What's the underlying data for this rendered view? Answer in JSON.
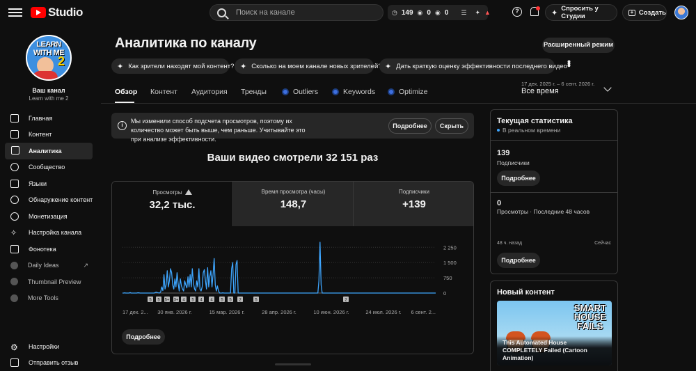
{
  "app": {
    "logo_text": "Studio"
  },
  "search": {
    "placeholder": "Поиск на канале"
  },
  "top_stats": {
    "views": "149",
    "a": "0",
    "b": "0"
  },
  "topbar": {
    "ask_label": "Спросить у Студии",
    "create_label": "Создать"
  },
  "channel": {
    "name": "Ваш канал",
    "handle": "Learn with me 2",
    "avatar_title": "LEARN WITH ME",
    "avatar_number": "2"
  },
  "sidebar": {
    "items": [
      {
        "label": "Главная",
        "icon": "dashboard-icon"
      },
      {
        "label": "Контент",
        "icon": "content-icon"
      },
      {
        "label": "Аналитика",
        "icon": "analytics-icon",
        "active": true
      },
      {
        "label": "Сообщество",
        "icon": "community-icon"
      },
      {
        "label": "Языки",
        "icon": "subtitles-icon"
      },
      {
        "label": "Обнаружение контент...",
        "icon": "copyright-icon"
      },
      {
        "label": "Монетизация",
        "icon": "monetization-icon"
      },
      {
        "label": "Настройка канала",
        "icon": "customization-icon"
      },
      {
        "label": "Фонотека",
        "icon": "audio-library-icon"
      },
      {
        "label": "Daily Ideas",
        "icon": "extension-icon"
      },
      {
        "label": "Thumbnail Preview",
        "icon": "extension-icon"
      },
      {
        "label": "More Tools",
        "icon": "extension-icon"
      }
    ],
    "bottom": [
      {
        "label": "Настройки",
        "icon": "gear-icon"
      },
      {
        "label": "Отправить отзыв",
        "icon": "feedback-icon"
      }
    ]
  },
  "page": {
    "title": "Аналитика по каналу",
    "advanced_mode": "Расширенный режим"
  },
  "chips": [
    "Как зрители находят мой контент?",
    "Сколько на моем канале новых зрителей?",
    "Дать краткую оценку эффективности последнего видео"
  ],
  "tabs": [
    "Обзор",
    "Контент",
    "Аудитория",
    "Тренды",
    "Outliers",
    "Keywords",
    "Optimize"
  ],
  "date": {
    "range": "17 дек. 2025 г. – 6 сент. 2026 г.",
    "value": "Все время"
  },
  "notice": {
    "text": "Мы изменили способ подсчета просмотров, поэтому их количество может быть выше, чем раньше. Учитывайте это при анализе эффективности.",
    "more": "Подробнее",
    "hide": "Скрыть"
  },
  "headline": "Ваши видео смотрели 32 151 раз",
  "metrics": [
    {
      "label": "Просмотры",
      "value": "32,2 тыс."
    },
    {
      "label": "Время просмотра (часы)",
      "value": "148,7"
    },
    {
      "label": "Подписчики",
      "value": "+139"
    }
  ],
  "card_more": "Подробнее",
  "chart_data": {
    "type": "line",
    "series": [
      {
        "values": [
          0,
          0,
          10,
          0,
          0,
          0,
          0,
          20,
          0,
          0,
          0,
          0,
          0,
          0,
          15,
          10,
          0,
          0,
          0,
          0,
          0,
          0,
          0,
          0,
          0,
          0,
          0,
          0,
          0,
          0,
          25,
          40,
          20,
          10,
          0,
          60,
          300,
          120,
          900,
          200,
          400,
          1100,
          300,
          600,
          1200,
          1000,
          400,
          200,
          700,
          300,
          1000,
          450,
          100,
          700,
          350,
          200,
          100,
          600,
          400,
          250,
          800,
          300,
          900,
          300,
          1200,
          500,
          200,
          100,
          600,
          300,
          1200,
          200,
          100,
          300,
          1000,
          1150,
          600,
          200,
          1250,
          300,
          800,
          1100,
          300,
          900,
          1700,
          400,
          100,
          350,
          100,
          0,
          0,
          0,
          10,
          0,
          0,
          0,
          0,
          0,
          0,
          0,
          1200,
          1500,
          0,
          0,
          1400,
          1600,
          0,
          0,
          0,
          0,
          0,
          0,
          0,
          0,
          0,
          0,
          0,
          0,
          0,
          0,
          0,
          0,
          0,
          0,
          0,
          0,
          0,
          0,
          0,
          0,
          0,
          0,
          0,
          0,
          0,
          0,
          0,
          0,
          0,
          0,
          0,
          0,
          0,
          0,
          0,
          0,
          0,
          0,
          0,
          0,
          0,
          0,
          0,
          0,
          0,
          0,
          0,
          0,
          0,
          0,
          0,
          0,
          0,
          0,
          0,
          0,
          0,
          0,
          0,
          0,
          0,
          0,
          0,
          0,
          0,
          0,
          0,
          0,
          0,
          0,
          600,
          2500,
          400,
          0,
          0,
          0,
          0,
          0,
          0,
          0,
          0,
          0,
          0,
          0,
          0,
          0,
          0,
          0,
          0,
          0,
          0,
          0,
          0,
          0,
          0,
          0,
          0,
          0,
          0,
          0,
          0,
          0,
          0,
          0,
          0,
          0,
          0,
          0,
          0,
          0,
          0,
          0,
          0,
          0,
          0,
          0,
          0,
          0,
          0,
          0,
          0,
          0,
          0,
          0,
          0,
          0,
          0,
          0,
          0,
          0,
          0,
          0,
          0,
          0,
          0,
          0,
          0,
          0,
          0,
          0,
          0,
          0,
          0,
          0,
          0,
          0,
          0,
          0,
          0,
          0,
          0,
          0,
          0,
          0,
          0,
          0,
          0,
          0,
          0,
          0,
          0,
          0,
          0,
          0,
          0,
          0,
          0,
          0,
          0,
          0,
          0,
          0,
          0,
          0,
          0,
          0,
          0,
          0
        ]
      }
    ],
    "y_ticks": [
      "2 250",
      "1 500",
      "750",
      "0"
    ],
    "y_tick_values": [
      2250,
      1500,
      750,
      0
    ],
    "ylim": [
      0,
      2500
    ],
    "x_tick_labels": [
      "17 дек. 2...",
      "30 янв. 2026 г.",
      "15 мар. 2026 г.",
      "28 апр. 2026 г.",
      "10 июн. 2026 г.",
      "24 июл. 2026 г.",
      "6 сент. 2..."
    ],
    "markers": [
      "5",
      "5",
      "5+",
      "3+",
      "4",
      "5",
      "4",
      "4",
      "5",
      "5",
      "2",
      "5",
      "2"
    ],
    "line_color": "#3ea6ff"
  },
  "realtime": {
    "title": "Текущая статистика",
    "live": "В реальном времени",
    "subs_value": "139",
    "subs_label": "Подписчики",
    "more1": "Подробнее",
    "views_value": "0",
    "views_label": "Просмотры · Последние 48 часов",
    "axis_left": "48 ч. назад",
    "axis_right": "Сейчас",
    "more2": "Подробнее"
  },
  "new_content": {
    "title": "Новый контент",
    "thumb_text_1": "SMART",
    "thumb_text_2": "HOUSE",
    "thumb_text_3": "FAILS",
    "video_title": "This Automated House COMPLETELY Failed (Cartoon Animation)"
  }
}
